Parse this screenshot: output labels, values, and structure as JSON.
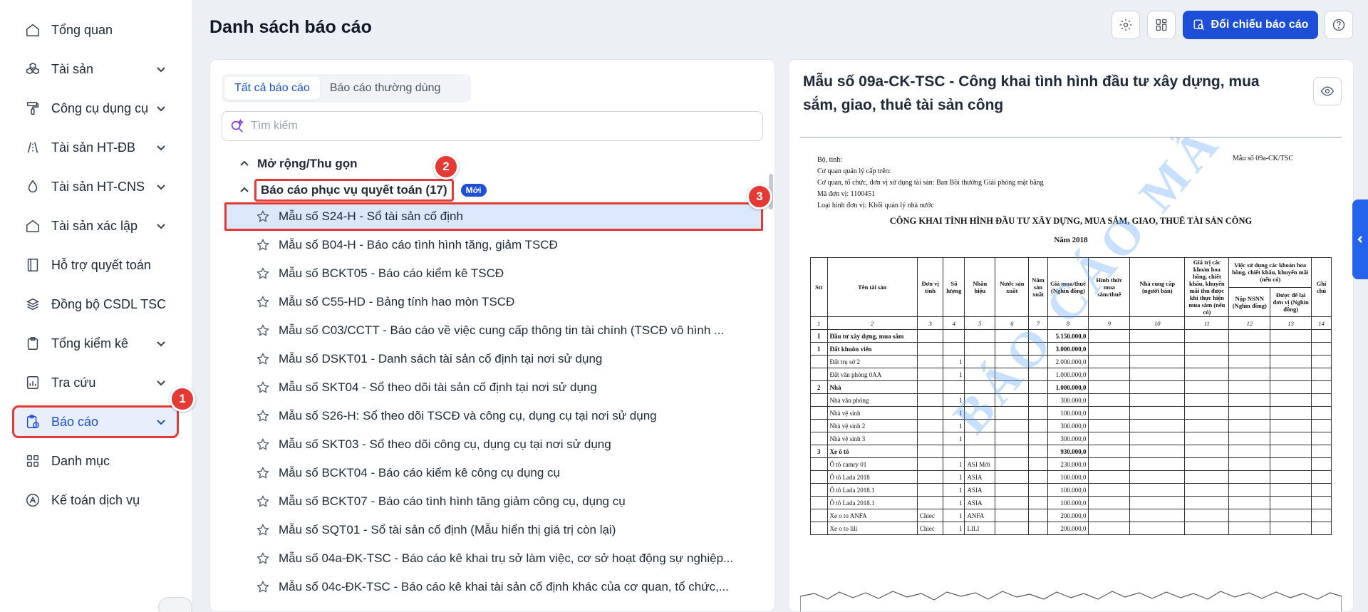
{
  "sidebar": {
    "items": [
      {
        "label": "Tổng quan",
        "icon": "home-icon",
        "chevron": false
      },
      {
        "label": "Tài sản",
        "icon": "boxes-icon",
        "chevron": true
      },
      {
        "label": "Công cụ dụng cụ",
        "icon": "paint-roller-icon",
        "chevron": true
      },
      {
        "label": "Tài sản HT-ĐB",
        "icon": "road-icon",
        "chevron": true
      },
      {
        "label": "Tài sản HT-CNS",
        "icon": "water-drop-icon",
        "chevron": true
      },
      {
        "label": "Tài sản xác lập",
        "icon": "home-icon",
        "chevron": true
      },
      {
        "label": "Hỗ trợ quyết toán",
        "icon": "book-icon",
        "chevron": false
      },
      {
        "label": "Đồng bộ CSDL TSC",
        "icon": "layers-icon",
        "chevron": false
      },
      {
        "label": "Tổng kiểm kê",
        "icon": "clipboard-icon",
        "chevron": true
      },
      {
        "label": "Tra cứu",
        "icon": "chart-icon",
        "chevron": true
      },
      {
        "label": "Báo cáo",
        "icon": "report-icon",
        "chevron": true,
        "active": true
      },
      {
        "label": "Danh mục",
        "icon": "grid-icon",
        "chevron": false
      },
      {
        "label": "Kế toán dịch vụ",
        "icon": "accounting-icon",
        "chevron": false
      }
    ]
  },
  "header": {
    "title": "Danh sách báo cáo",
    "compare_button": "Đối chiếu báo cáo"
  },
  "left_panel": {
    "tabs": [
      {
        "label": "Tất cả báo cáo",
        "active": true
      },
      {
        "label": "Báo cáo thường dùng",
        "active": false
      }
    ],
    "search": {
      "placeholder": "Tìm kiếm",
      "value": ""
    },
    "expand_label": "Mở rộng/Thu gọn",
    "group": {
      "label": "Báo cáo phục vụ quyết toán (17)",
      "badge": "Mới"
    },
    "reports": [
      "Mẫu số S24-H - Sổ tài sản cố định",
      "Mẫu số B04-H - Báo cáo tình hình tăng, giảm TSCĐ",
      "Mẫu số BCKT05 - Báo cáo kiểm kê TSCĐ",
      "Mẫu số C55-HD - Bảng tính hao mòn TSCĐ",
      "Mẫu số C03/CCTT - Báo cáo về việc cung cấp thông tin tài chính (TSCĐ vô hình ...",
      "Mẫu số DSKT01 - Danh sách tài sản cố định tại nơi sử dụng",
      "Mẫu số SKT04 - Sổ theo dõi tài sản cố định tại nơi sử dụng",
      "Mẫu số S26-H: Sổ theo dõi TSCĐ và công cụ, dụng cụ tại nơi sử dụng",
      "Mẫu số SKT03 - Sổ theo dõi công cụ, dụng cụ tại nơi sử dụng",
      "Mẫu số BCKT04 - Báo cáo kiểm kê công cụ dụng cụ",
      "Mẫu số BCKT07 - Báo cáo tình hình tăng giảm công cụ, dụng cụ",
      "Mẫu số SQT01 - Sổ tài sản cố định (Mẫu hiển thị giá trị còn lại)",
      "Mẫu số 04a-ĐK-TSC - Báo cáo kê khai trụ sở làm việc, cơ sở hoạt động sự nghiệp...",
      "Mẫu số 04c-ĐK-TSC - Báo cáo kê khai tài sản cố định khác của cơ quan, tổ chức,..."
    ],
    "selected_index": 0
  },
  "steps": [
    "1",
    "2",
    "3"
  ],
  "right_panel": {
    "title": "Mẫu số 09a-CK-TSC - Công khai tình hình đầu tư xây dựng, mua sắm, giao, thuê tài sản công",
    "document": {
      "meta_lines": [
        "Bộ, tỉnh:",
        "Cơ quan quản lý cấp trên:",
        "Cơ quan, tổ chức, đơn vị sử dụng tài sản: Ban Bồi thường Giải phóng mặt bằng",
        "Mã đơn vị: 1100451",
        "Loại hình đơn vị: Khối quản lý nhà nước"
      ],
      "form_no": "Mẫu số 09a-CK/TSC",
      "heading": "CÔNG KHAI TÌNH HÌNH ĐẦU TƯ XÂY DỰNG, MUA SẮM, GIAO, THUÊ TÀI SẢN CÔNG",
      "year": "Năm 2018",
      "watermark": "BÁO CÁO MẪU",
      "columns": [
        "Stt",
        "Tên tài sản",
        "Đơn vị tính",
        "Số lượng",
        "Nhãn hiệu",
        "Nước sản xuất",
        "Năm sản xuất",
        "Giá mua/thuê (Nghìn đồng)",
        "Hình thức mua sắm/thuê",
        "Nhà cung cấp (người bán)",
        "Giá trị các khoản hoa hồng, chiết khấu, khuyến mãi thu được khi thực hiện mua sắm (nếu có)",
        "Việc sử dụng các khoản hoa hồng, chiết khấu, khuyến mãi (nếu có)",
        "Nộp NSNN (Nghìn đồng)",
        "Được để lại đơn vị (Nghìn đồng)",
        "Ghi chú"
      ],
      "col_index": [
        "1",
        "2",
        "3",
        "4",
        "5",
        "6",
        "7",
        "8",
        "9",
        "10",
        "11",
        "12",
        "13",
        "14"
      ],
      "rows": [
        {
          "stt": "I",
          "name": "Đầu tư xây dựng, mua sắm",
          "unit": "",
          "qty": "",
          "brand": "",
          "price": "5.150.000,0",
          "bold": true
        },
        {
          "stt": "1",
          "name": "Đất khuôn viên",
          "unit": "",
          "qty": "",
          "brand": "",
          "price": "3.000.000,0",
          "bold": true
        },
        {
          "stt": "",
          "name": "Đất trụ sở 2",
          "unit": "",
          "qty": "1",
          "brand": "",
          "price": "2.000.000,0",
          "bold": false
        },
        {
          "stt": "",
          "name": "Đất văn phòng 0AA",
          "unit": "",
          "qty": "1",
          "brand": "",
          "price": "1.000.000,0",
          "bold": false
        },
        {
          "stt": "2",
          "name": "Nhà",
          "unit": "",
          "qty": "",
          "brand": "",
          "price": "1.000.000,0",
          "bold": true
        },
        {
          "stt": "",
          "name": "Nhà văn phòng",
          "unit": "",
          "qty": "1",
          "brand": "",
          "price": "300.000,0",
          "bold": false
        },
        {
          "stt": "",
          "name": "Nhà vệ sinh",
          "unit": "",
          "qty": "1",
          "brand": "",
          "price": "100.000,0",
          "bold": false
        },
        {
          "stt": "",
          "name": "Nhà vệ sinh 2",
          "unit": "",
          "qty": "1",
          "brand": "",
          "price": "300.000,0",
          "bold": false
        },
        {
          "stt": "",
          "name": "Nhà vệ sinh 3",
          "unit": "",
          "qty": "1",
          "brand": "",
          "price": "300.000,0",
          "bold": false
        },
        {
          "stt": "3",
          "name": "Xe ô tô",
          "unit": "",
          "qty": "",
          "brand": "",
          "price": "930.000,0",
          "bold": true
        },
        {
          "stt": "",
          "name": "Ô tô camry 01",
          "unit": "",
          "qty": "1",
          "brand": "ASI Mới",
          "price": "230.000,0",
          "bold": false
        },
        {
          "stt": "",
          "name": "Ô tô Lada 2018",
          "unit": "",
          "qty": "1",
          "brand": "ASIA",
          "price": "100.000,0",
          "bold": false
        },
        {
          "stt": "",
          "name": "Ô tô Lada 2018.1",
          "unit": "",
          "qty": "1",
          "brand": "ASIA",
          "price": "100.000,0",
          "bold": false
        },
        {
          "stt": "",
          "name": "Ô tô Lada 2018.1",
          "unit": "",
          "qty": "1",
          "brand": "ASIA",
          "price": "100.000,0",
          "bold": false
        },
        {
          "stt": "",
          "name": "Xe o to ANFA",
          "unit": "Chiec",
          "qty": "1",
          "brand": "ANFA",
          "price": "200.000,0",
          "bold": false
        },
        {
          "stt": "",
          "name": "Xe o to lili",
          "unit": "Chiec",
          "qty": "1",
          "brand": "LILI",
          "price": "200.000,0",
          "bold": false
        }
      ]
    }
  },
  "colors": {
    "primary": "#1d4ed8",
    "highlight": "#e53935",
    "selected_bg": "#dbe7fb"
  }
}
